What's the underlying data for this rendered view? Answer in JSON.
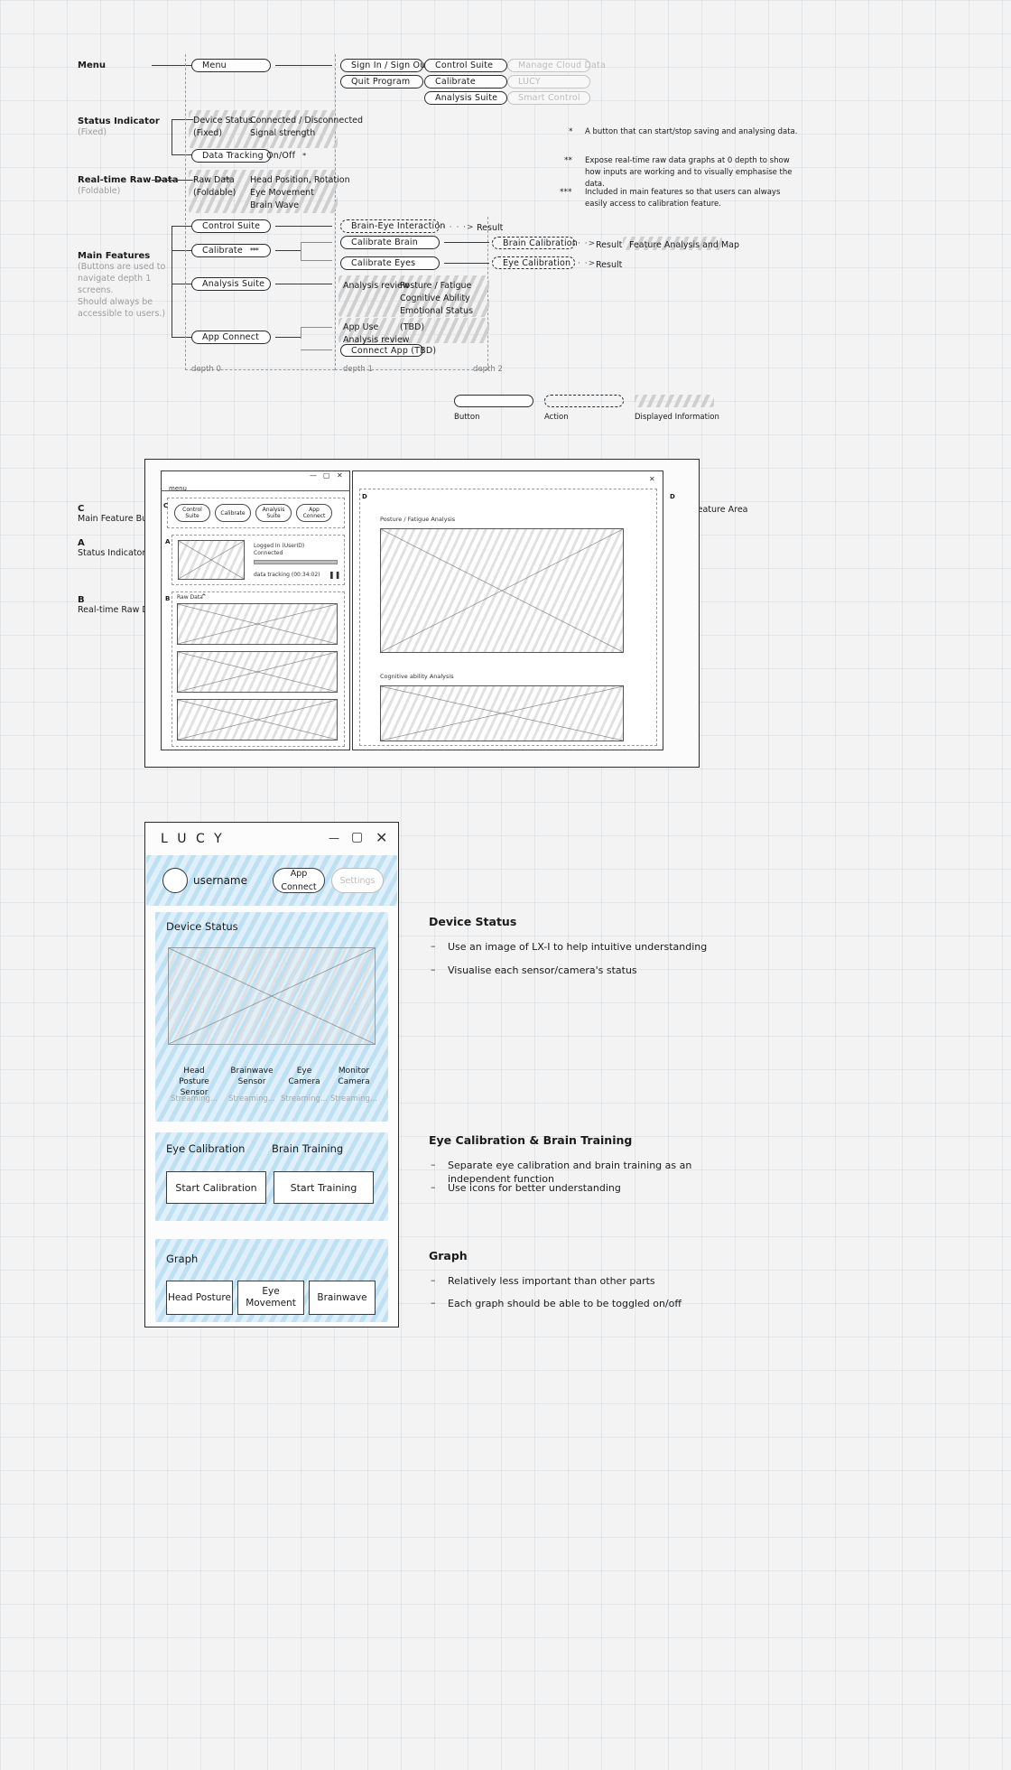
{
  "flow": {
    "left_labels": [
      {
        "title": "Menu",
        "sub": ""
      },
      {
        "title": "Status Indicator",
        "sub": "(Fixed)"
      },
      {
        "title": "Real-time Raw Data",
        "sub": "(Foldable)"
      },
      {
        "title": "Main Features",
        "sub": "(Buttons are used to\nnavigate depth 1 screens.\nShould always be\naccessible to users.)"
      }
    ],
    "depth0": {
      "menu_button": "Menu",
      "device_status_label": "Device Status\n(Fixed)",
      "device_status_values": "Connected / Disconnected\nSignal strength",
      "data_tracking_button": "Data Tracking On/Off",
      "data_tracking_stars": "*",
      "raw_data_label": "Raw Data\n(Foldable)",
      "raw_data_stars": "**",
      "raw_data_values": "Head Position, Rotation\nEye Movement\nBrain Wave",
      "buttons": [
        {
          "label": "Control Suite",
          "stars": ""
        },
        {
          "label": "Calibrate",
          "stars": "***"
        },
        {
          "label": "Analysis Suite",
          "stars": ""
        },
        {
          "label": "App Connect",
          "stars": ""
        }
      ]
    },
    "menu_col1": [
      "Sign In / Sign Out",
      "Quit Program"
    ],
    "menu_col2": [
      "Control Suite",
      "Calibrate",
      "Analysis Suite"
    ],
    "menu_col3": [
      "Manage Cloud Data",
      "LUCY",
      "Smart Control"
    ],
    "depth1": {
      "brain_eye": "Brain-Eye Interaction",
      "brain_eye_result": "Result",
      "calibrate_brain": "Calibrate Brain",
      "calibrate_eyes": "Calibrate Eyes",
      "analysis_review_label": "Analysis review",
      "analysis_review_values": "Posture / Fatigue\nCognitive Ability\nEmotional Status",
      "app_use_label": "App Use\nAnalysis review",
      "app_use_value": "(TBD)",
      "connect_app": "Connect App (TBD)"
    },
    "depth2": {
      "brain_calibration": "Brain Calibration",
      "brain_result": "Result",
      "eye_calibration": "Eye Calibration",
      "eye_result": "Result",
      "feature_map": "Feature Analysis and Map"
    },
    "depth_labels": [
      "depth 0",
      "depth 1",
      "depth 2"
    ],
    "footnotes": [
      {
        "mark": "*",
        "text": "A button that can start/stop saving and analysing data."
      },
      {
        "mark": "**",
        "text": "Expose real-time raw data graphs at 0 depth to show\nhow inputs are working and to visually emphasise the\ndata."
      },
      {
        "mark": "***",
        "text": "Included in main features so that users can always\neasily access to calibration feature."
      }
    ],
    "legend": [
      {
        "label": "Button",
        "kind": "solid"
      },
      {
        "label": "Action",
        "kind": "dashed"
      },
      {
        "label": "Displayed Information",
        "kind": "scribble"
      }
    ]
  },
  "wireframe": {
    "left_notes": [
      {
        "key": "C",
        "text": "Main Feature Buttons"
      },
      {
        "key": "A",
        "text": "Status Indicator"
      },
      {
        "key": "B",
        "text": "Real-time Raw Data"
      }
    ],
    "right_note": {
      "key": "D",
      "text": "Main Feature Area"
    },
    "markers": {
      "c": "C",
      "a": "A",
      "b": "B",
      "d_left": "D",
      "d_right": "D"
    },
    "window": {
      "title": "menu",
      "min": "—",
      "max": "▢",
      "close": "✕"
    },
    "tabs": [
      "Control\nSuite",
      "Calibrate",
      "Analysis\nSuite",
      "App\nConnect"
    ],
    "status": {
      "login": "Logged In (UserID)",
      "connected": "Connected",
      "tracking": "data tracking (00:34:02)",
      "pause_icon": "❚❚"
    },
    "raw_data": {
      "label": "Raw Data",
      "chevron": "⌃"
    },
    "main_area": {
      "close": "✕",
      "chart1_title": "Posture / Fatigue  Analysis",
      "chart2_title": "Cognitive ability Analysis"
    }
  },
  "hifi": {
    "titlebar": {
      "brand": "L U C Y",
      "min": "—",
      "max": "▢",
      "close": "✕"
    },
    "account": {
      "username": "username",
      "app_connect": "App Connect",
      "settings": "Settings"
    },
    "device_status": {
      "title": "Device Status",
      "sensors": [
        {
          "name": "Head Posture\nSensor",
          "status": "Streaming..."
        },
        {
          "name": "Brainwave\nSensor",
          "status": "Streaming..."
        },
        {
          "name": "Eye\nCamera",
          "status": "Streaming..."
        },
        {
          "name": "Monitor\nCamera",
          "status": "Streaming..."
        }
      ]
    },
    "calibration": {
      "eye_title": "Eye Calibration",
      "brain_title": "Brain Training",
      "eye_button": "Start Calibration",
      "brain_button": "Start Training"
    },
    "graph": {
      "title": "Graph",
      "buttons": [
        "Head\nPosture",
        "Eye\nMovement",
        "Brainwave"
      ]
    },
    "notes": [
      {
        "heading": "Device Status",
        "items": [
          "Use an image of LX-I to help intuitive understanding",
          "Visualise each sensor/camera's status"
        ]
      },
      {
        "heading": "Eye Calibration & Brain Training",
        "items": [
          "Separate eye calibration and brain training as an independent function",
          "Use icons for better understanding"
        ]
      },
      {
        "heading": "Graph",
        "items": [
          "Relatively less important than other parts",
          "Each graph should be able to be toggled on/off"
        ]
      }
    ],
    "dash": "–"
  }
}
